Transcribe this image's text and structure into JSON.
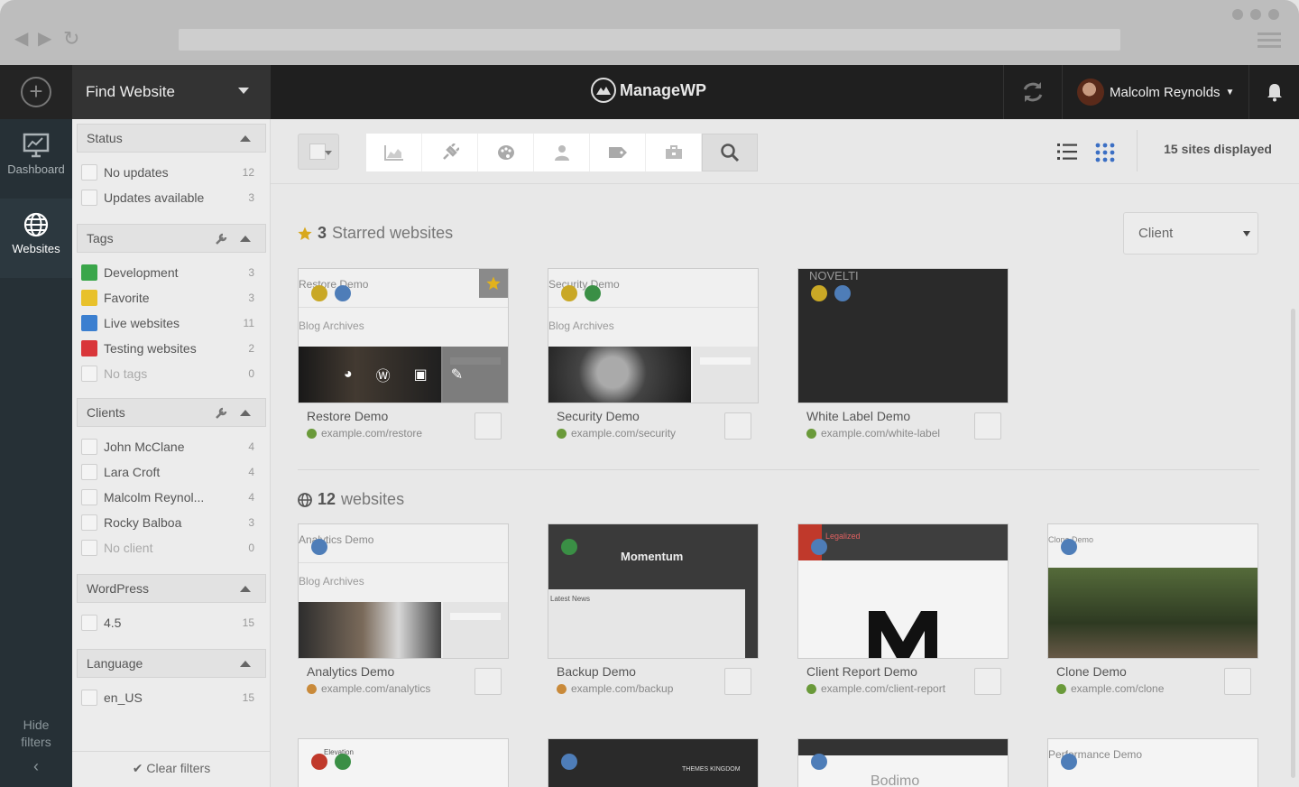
{
  "app": {
    "brand": "ManageWP"
  },
  "header": {
    "find_website": "Find Website",
    "user_name": "Malcolm Reynolds"
  },
  "leftnav": {
    "items": [
      {
        "label": "Dashboard",
        "icon": "dashboard-icon"
      },
      {
        "label": "Websites",
        "icon": "globe-icon"
      }
    ],
    "hide_filters_line1": "Hide",
    "hide_filters_line2": "filters"
  },
  "filters": {
    "status": {
      "title": "Status",
      "items": [
        {
          "label": "No updates",
          "count": "12"
        },
        {
          "label": "Updates available",
          "count": "3"
        }
      ]
    },
    "tags": {
      "title": "Tags",
      "items": [
        {
          "label": "Development",
          "count": "3",
          "color": "#3aa64a"
        },
        {
          "label": "Favorite",
          "count": "3",
          "color": "#e8c12b"
        },
        {
          "label": "Live websites",
          "count": "11",
          "color": "#3b7fd0"
        },
        {
          "label": "Testing websites",
          "count": "2",
          "color": "#d9363a"
        },
        {
          "label": "No tags",
          "count": "0"
        }
      ]
    },
    "clients": {
      "title": "Clients",
      "items": [
        {
          "label": "John McClane",
          "count": "4"
        },
        {
          "label": "Lara Croft",
          "count": "4"
        },
        {
          "label": "Malcolm Reynol...",
          "count": "4"
        },
        {
          "label": "Rocky Balboa",
          "count": "3"
        },
        {
          "label": "No client",
          "count": "0"
        }
      ]
    },
    "wordpress": {
      "title": "WordPress",
      "items": [
        {
          "label": "4.5",
          "count": "15"
        }
      ]
    },
    "language": {
      "title": "Language",
      "items": [
        {
          "label": "en_US",
          "count": "15"
        }
      ]
    },
    "clear": "Clear filters"
  },
  "toolbar": {
    "sites_count": "15",
    "sites_label": "sites displayed"
  },
  "starred": {
    "count": "3",
    "label": "Starred websites",
    "client_select": "Client",
    "cards": [
      {
        "name": "Restore Demo",
        "url": "example.com/restore",
        "page_title": "Restore Demo",
        "blog": "Blog Archives"
      },
      {
        "name": "Security Demo",
        "url": "example.com/security",
        "page_title": "Security Demo",
        "blog": "Blog Archives"
      },
      {
        "name": "White Label Demo",
        "url": "example.com/white-label",
        "page_title": "NOVELTI"
      }
    ]
  },
  "all": {
    "count": "12",
    "label": "websites",
    "cards": [
      {
        "name": "Analytics Demo",
        "url": "example.com/analytics",
        "page_title": "Analytics Demo",
        "blog": "Blog Archives"
      },
      {
        "name": "Backup Demo",
        "url": "example.com/backup",
        "page_title": "Momentum",
        "blog": "Latest News"
      },
      {
        "name": "Client Report Demo",
        "url": "example.com/client-report",
        "page_title": "Legalized"
      },
      {
        "name": "Clone Demo",
        "url": "example.com/clone",
        "page_title": "Clone Demo"
      }
    ],
    "row3": [
      {
        "page_title": "Elevation"
      },
      {
        "page_title": "THEMES KINGDOM"
      },
      {
        "page_title": "Bodimo"
      },
      {
        "page_title": "Performance Demo"
      }
    ]
  }
}
